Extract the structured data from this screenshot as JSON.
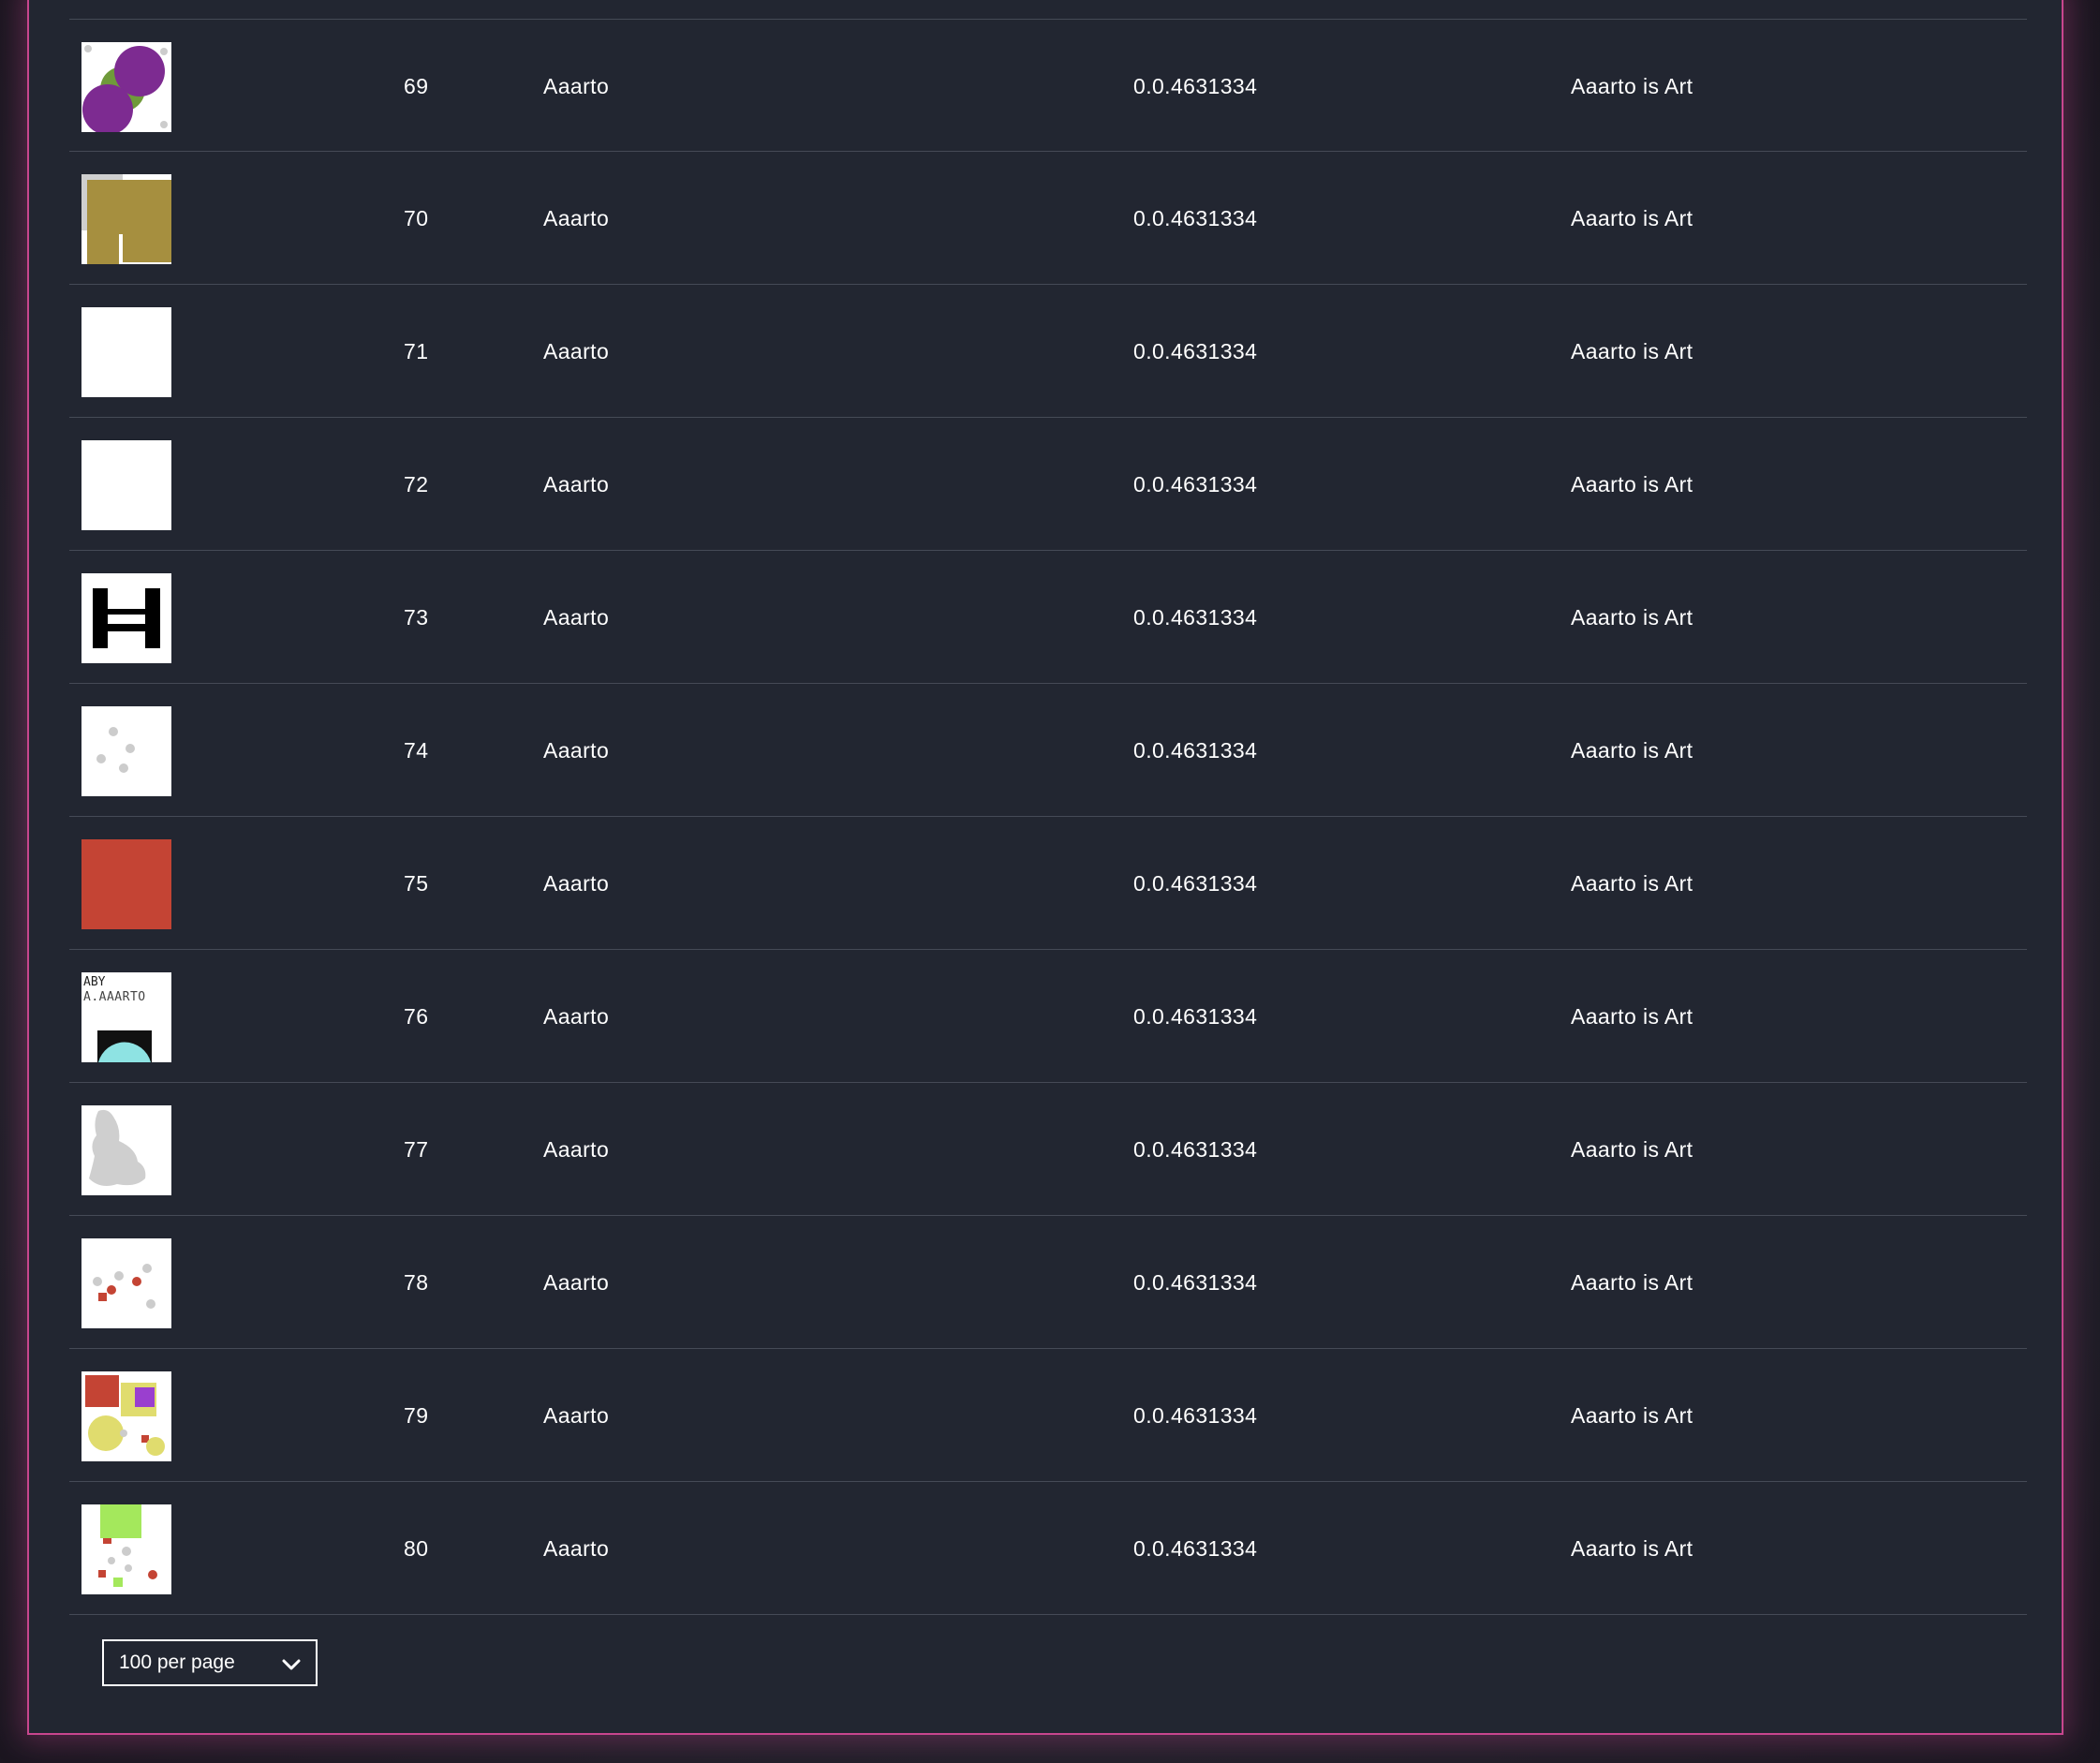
{
  "table": {
    "rows": [
      {
        "id": "69",
        "name": "Aaarto",
        "version": "0.0.4631334",
        "collection": "Aaarto is Art",
        "thumbnail": "purple-green-circles"
      },
      {
        "id": "70",
        "name": "Aaarto",
        "version": "0.0.4631334",
        "collection": "Aaarto is Art",
        "thumbnail": "gold-block"
      },
      {
        "id": "71",
        "name": "Aaarto",
        "version": "0.0.4631334",
        "collection": "Aaarto is Art",
        "thumbnail": "blank-white"
      },
      {
        "id": "72",
        "name": "Aaarto",
        "version": "0.0.4631334",
        "collection": "Aaarto is Art",
        "thumbnail": "blank-white"
      },
      {
        "id": "73",
        "name": "Aaarto",
        "version": "0.0.4631334",
        "collection": "Aaarto is Art",
        "thumbnail": "black-h-shape"
      },
      {
        "id": "74",
        "name": "Aaarto",
        "version": "0.0.4631334",
        "collection": "Aaarto is Art",
        "thumbnail": "grey-dots"
      },
      {
        "id": "75",
        "name": "Aaarto",
        "version": "0.0.4631334",
        "collection": "Aaarto is Art",
        "thumbnail": "red-square"
      },
      {
        "id": "76",
        "name": "Aaarto",
        "version": "0.0.4631334",
        "collection": "Aaarto is Art",
        "thumbnail": "text-cyan-dome"
      },
      {
        "id": "77",
        "name": "Aaarto",
        "version": "0.0.4631334",
        "collection": "Aaarto is Art",
        "thumbnail": "grey-blob"
      },
      {
        "id": "78",
        "name": "Aaarto",
        "version": "0.0.4631334",
        "collection": "Aaarto is Art",
        "thumbnail": "red-grey-dots"
      },
      {
        "id": "79",
        "name": "Aaarto",
        "version": "0.0.4631334",
        "collection": "Aaarto is Art",
        "thumbnail": "red-yellow-purple-shapes"
      },
      {
        "id": "80",
        "name": "Aaarto",
        "version": "0.0.4631334",
        "collection": "Aaarto is Art",
        "thumbnail": "green-block-dots"
      }
    ]
  },
  "pagination": {
    "per_page_label": "100 per page",
    "chevron_icon": "chevron-down-icon"
  },
  "colors": {
    "panel_background": "#222631",
    "panel_border": "#c8468e",
    "row_divider": "#454a56",
    "text": "#ffffff"
  }
}
